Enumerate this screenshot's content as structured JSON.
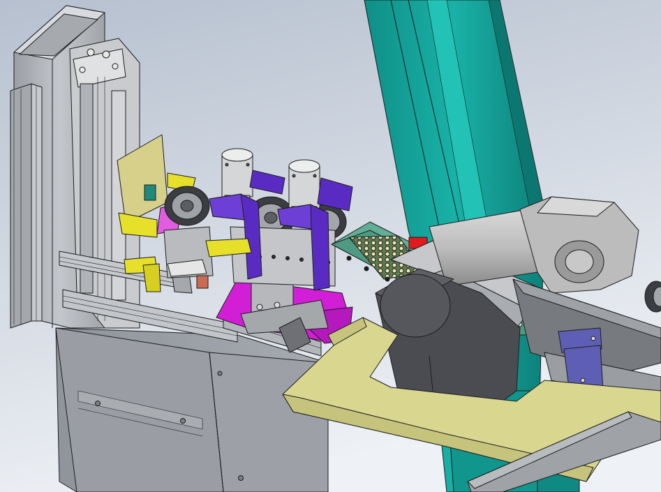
{
  "palette": {
    "background_top": "#b9c4d3",
    "background_bottom": "#e9edf2",
    "frame_gray": "#b8bcc2",
    "frame_dark": "#8e9298",
    "teal_column": "#14a39a",
    "teal_dark": "#0c7c75",
    "yellow_plate": "#d9d690",
    "yellow_bracket": "#e6e02a",
    "purple_bracket": "#5a2bc2",
    "blue_plate": "#5e5fb4",
    "magenta_plate": "#d21fd6",
    "green_rail": "#5fae95",
    "red_part": "#e11b1b",
    "motor_gray": "#c3c3c3"
  }
}
